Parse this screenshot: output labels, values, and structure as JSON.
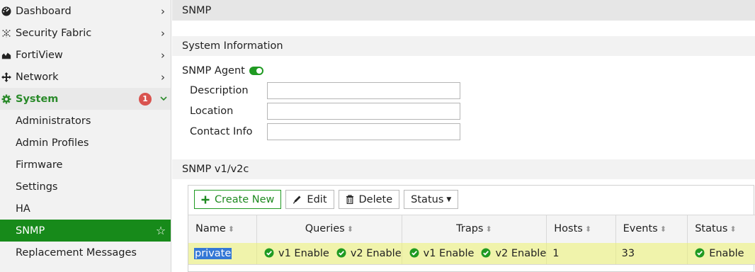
{
  "sidebar": {
    "items": [
      {
        "label": "Dashboard",
        "icon": "dashboard-icon"
      },
      {
        "label": "Security Fabric",
        "icon": "security-fabric-icon"
      },
      {
        "label": "FortiView",
        "icon": "fortiview-icon"
      },
      {
        "label": "Network",
        "icon": "network-icon"
      },
      {
        "label": "System",
        "icon": "gear-icon",
        "badge": "1"
      }
    ],
    "sub_items": [
      {
        "label": "Administrators"
      },
      {
        "label": "Admin Profiles"
      },
      {
        "label": "Firmware"
      },
      {
        "label": "Settings"
      },
      {
        "label": "HA"
      },
      {
        "label": "SNMP"
      },
      {
        "label": "Replacement Messages"
      }
    ]
  },
  "page": {
    "title": "SNMP",
    "system_info_heading": "System Information",
    "snmp_agent_label": "SNMP Agent",
    "snmp_agent_enabled": true,
    "fields": {
      "description": {
        "label": "Description",
        "value": ""
      },
      "location": {
        "label": "Location",
        "value": ""
      },
      "contact": {
        "label": "Contact Info",
        "value": ""
      }
    },
    "v1v2c_heading": "SNMP v1/v2c"
  },
  "toolbar": {
    "create_label": "Create New",
    "edit_label": "Edit",
    "delete_label": "Delete",
    "status_label": "Status"
  },
  "table": {
    "headers": {
      "name": "Name",
      "queries": "Queries",
      "traps": "Traps",
      "hosts": "Hosts",
      "events": "Events",
      "status": "Status"
    },
    "rows": [
      {
        "name": "private",
        "queries_v1": "v1 Enable",
        "queries_v2": "v2 Enable",
        "traps_v1": "v1 Enable",
        "traps_v2": "v2 Enable",
        "hosts": "1",
        "events": "33",
        "status": "Enable"
      }
    ]
  },
  "colors": {
    "accent_green": "#178a1a",
    "selected_row": "#f0f3ab",
    "badge_red": "#d9534f",
    "selection_blue": "#3478d6"
  }
}
